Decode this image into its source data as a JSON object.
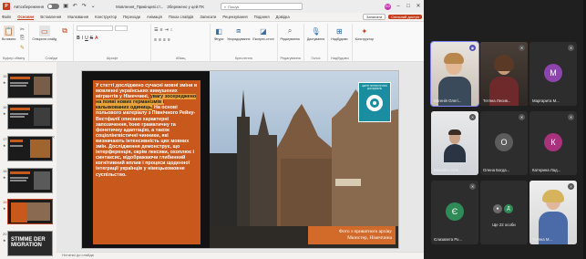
{
  "titlebar": {
    "autosave_label": "Автозбереження",
    "file_title": "Мовлення_Прикінцеві.ст...",
    "status": "Збережено у цей ПК",
    "search_placeholder": "Пошук",
    "user_initials": "ЄО"
  },
  "tabs": [
    "Файл",
    "Основне",
    "Вставлення",
    "Малювання",
    "Конструктор",
    "Переходи",
    "Анімація",
    "Показ слайдів",
    "Записати",
    "Рецензування",
    "Подання",
    "Довідка"
  ],
  "tabs_right": {
    "record": "Записати",
    "share": "Спільний доступ"
  },
  "ribbon": {
    "groups": [
      {
        "label": "Буфер обміну",
        "buttons": [
          "Вставити"
        ]
      },
      {
        "label": "Слайди",
        "buttons": [
          "Створити слайд",
          "Повторно використати слайди"
        ]
      },
      {
        "label": "Шрифт",
        "buttons": []
      },
      {
        "label": "Абзац",
        "buttons": []
      },
      {
        "label": "Креслення",
        "buttons": [
          "Фігури",
          "Упорядкування",
          "Експрес-стилі"
        ]
      },
      {
        "label": "Редагування",
        "buttons": [
          "Редагування"
        ]
      },
      {
        "label": "Голос",
        "buttons": [
          "Диктування"
        ]
      },
      {
        "label": "Надбудови",
        "buttons": [
          "Надбудови"
        ]
      },
      {
        "label": "",
        "buttons": [
          "Конструктор"
        ]
      }
    ]
  },
  "thumbnails": [
    {
      "num": "15",
      "title": ""
    },
    {
      "num": "16",
      "title": ""
    },
    {
      "num": "17",
      "title": ""
    },
    {
      "num": "18",
      "title": ""
    },
    {
      "num": "19",
      "title": ""
    },
    {
      "num": "20",
      "title": "STIMME DER MIGRATION"
    }
  ],
  "slide": {
    "text_before": "У статті досліджено сучасні мовні зміни в мовленні українських вимушених мігрантів у Німеччині, ",
    "text_highlight": "увагу зосереджено на появі нових германізмів і кальккованих одиниць.",
    "text_after": " На основі польового матеріалу з Північного Рейну-Вестфалії описано характерні запозичення, їхню граматичну та фонетичну адаптацію, а також соціолінгвістичні чинники, які визначають інтенсивність цих мовних змін. Дослідження демонструє, що інтерференція, окрім лексики, охоплює і синтаксис, відображаючи глибинний когнітивний вплив і процеси щоденної інтеграції українців у німецькомовне суспільство.",
    "caption_line1": "Фото з приватного архіву",
    "caption_line2": "Мюнстер, Німеччина",
    "logo_text": "ЦЕНТР ЛІНГВІСТИЧНИХ ДОСЛІДЖЕНЬ"
  },
  "notes_placeholder": "Нотатки до слайда",
  "teams": {
    "participants": [
      {
        "name": "Євгенія Олегі...",
        "initial": "",
        "color": "",
        "video": true
      },
      {
        "name": "Тетяна Лесив...",
        "initial": "",
        "color": "",
        "video": true
      },
      {
        "name": "Маргарита М...",
        "initial": "М",
        "color": "#8e44ad",
        "video": false
      },
      {
        "name": "Михайло Оле...",
        "initial": "",
        "color": "",
        "video": true
      },
      {
        "name": "Олена Богда...",
        "initial": "О",
        "color": "#5c5c5c",
        "video": false
      },
      {
        "name": "Катерина Лад...",
        "initial": "К",
        "color": "#a8327e",
        "video": false
      },
      {
        "name": "Єлизавета Ро...",
        "initial": "Є",
        "color": "#2e8b57",
        "video": false
      },
      {
        "name": "Ще 22 особи",
        "initial": "",
        "color": "",
        "video": false
      },
      {
        "name": "Тетяна М...",
        "initial": "",
        "color": "",
        "video": true
      }
    ]
  }
}
